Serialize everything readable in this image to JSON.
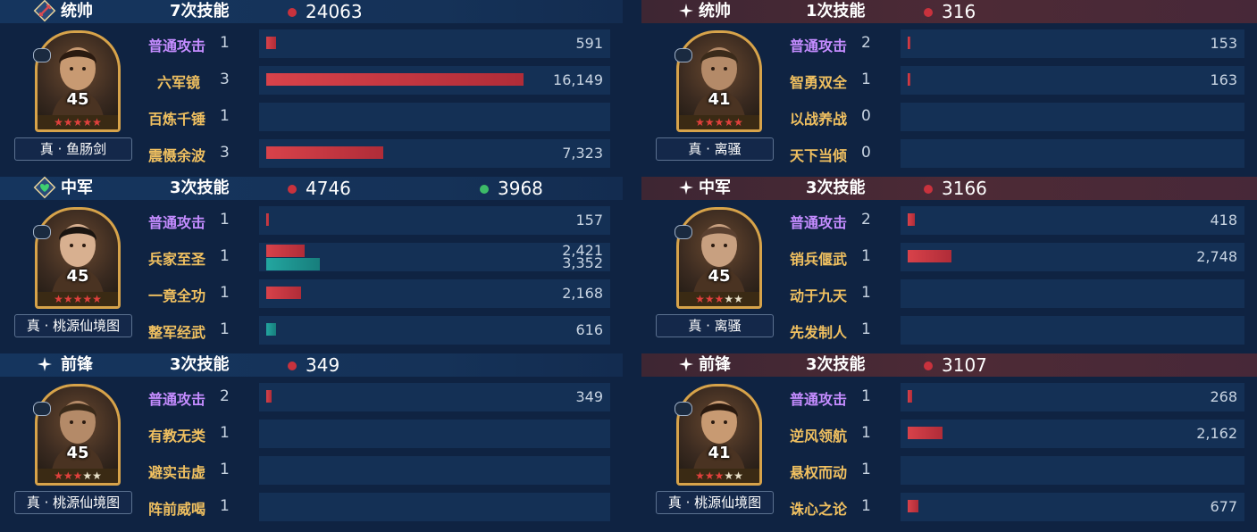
{
  "left": {
    "sections": [
      {
        "role": "统帅",
        "role_icon": "sword-badge-icon",
        "skill_count": "7次技能",
        "damage": "24063",
        "heal": null,
        "level": "45",
        "stars_red": 5,
        "gear": "真 · 鱼肠剑",
        "skills": [
          {
            "name": "普通攻击",
            "level": "1",
            "type": "normal",
            "damage": 591,
            "damage_label": "591",
            "heal": null
          },
          {
            "name": "六军镜",
            "level": "3",
            "type": "skill",
            "damage": 16149,
            "damage_label": "16,149",
            "heal": null
          },
          {
            "name": "百炼千锤",
            "level": "1",
            "type": "skill",
            "damage": null,
            "damage_label": "",
            "heal": null
          },
          {
            "name": "震慑余波",
            "level": "3",
            "type": "skill",
            "damage": 7323,
            "damage_label": "7,323",
            "heal": null
          }
        ]
      },
      {
        "role": "中军",
        "role_icon": "heart-badge-icon",
        "skill_count": "3次技能",
        "damage": "4746",
        "heal": "3968",
        "level": "45",
        "stars_red": 5,
        "gear": "真 · 桃源仙境图",
        "skills": [
          {
            "name": "普通攻击",
            "level": "1",
            "type": "normal",
            "damage": 157,
            "damage_label": "157",
            "heal": null
          },
          {
            "name": "兵家至圣",
            "level": "1",
            "type": "skill",
            "damage": 2421,
            "damage_label": "2,421",
            "heal": 3352,
            "heal_label": "3,352"
          },
          {
            "name": "一竟全功",
            "level": "1",
            "type": "skill",
            "damage": 2168,
            "damage_label": "2,168",
            "heal": null
          },
          {
            "name": "整军经武",
            "level": "1",
            "type": "skill",
            "damage": null,
            "damage_label": "",
            "heal": 616,
            "heal_label": "616"
          }
        ]
      },
      {
        "role": "前锋",
        "role_icon": "sparkle-icon",
        "skill_count": "3次技能",
        "damage": "349",
        "heal": null,
        "level": "45",
        "stars_red": 3,
        "gear": "真 · 桃源仙境图",
        "skills": [
          {
            "name": "普通攻击",
            "level": "2",
            "type": "normal",
            "damage": 349,
            "damage_label": "349",
            "heal": null
          },
          {
            "name": "有教无类",
            "level": "1",
            "type": "skill",
            "damage": null,
            "damage_label": "",
            "heal": null
          },
          {
            "name": "避实击虚",
            "level": "1",
            "type": "skill",
            "damage": null,
            "damage_label": "",
            "heal": null
          },
          {
            "name": "阵前威喝",
            "level": "1",
            "type": "skill",
            "damage": null,
            "damage_label": "",
            "heal": null
          }
        ]
      }
    ],
    "max_value": 16149
  },
  "right": {
    "sections": [
      {
        "role": "统帅",
        "role_icon": "sparkle-icon",
        "skill_count": "1次技能",
        "damage": "316",
        "heal": null,
        "level": "41",
        "stars_red": 5,
        "gear": "真 · 离骚",
        "skills": [
          {
            "name": "普通攻击",
            "level": "2",
            "type": "normal",
            "damage": 153,
            "damage_label": "153",
            "heal": null
          },
          {
            "name": "智勇双全",
            "level": "1",
            "type": "skill",
            "damage": 163,
            "damage_label": "163",
            "heal": null
          },
          {
            "name": "以战养战",
            "level": "0",
            "type": "skill",
            "damage": null,
            "damage_label": "",
            "heal": null
          },
          {
            "name": "天下当倾",
            "level": "0",
            "type": "skill",
            "damage": null,
            "damage_label": "",
            "heal": null
          }
        ]
      },
      {
        "role": "中军",
        "role_icon": "sparkle-icon",
        "skill_count": "3次技能",
        "damage": "3166",
        "heal": null,
        "level": "45",
        "stars_red": 3,
        "gear": "真 · 离骚",
        "skills": [
          {
            "name": "普通攻击",
            "level": "2",
            "type": "normal",
            "damage": 418,
            "damage_label": "418",
            "heal": null
          },
          {
            "name": "销兵偃武",
            "level": "1",
            "type": "skill",
            "damage": 2748,
            "damage_label": "2,748",
            "heal": null
          },
          {
            "name": "动于九天",
            "level": "1",
            "type": "skill",
            "damage": null,
            "damage_label": "",
            "heal": null
          },
          {
            "name": "先发制人",
            "level": "1",
            "type": "skill",
            "damage": null,
            "damage_label": "",
            "heal": null
          }
        ]
      },
      {
        "role": "前锋",
        "role_icon": "sparkle-icon",
        "skill_count": "3次技能",
        "damage": "3107",
        "heal": null,
        "level": "41",
        "stars_red": 3,
        "gear": "真 · 桃源仙境图",
        "skills": [
          {
            "name": "普通攻击",
            "level": "1",
            "type": "normal",
            "damage": 268,
            "damage_label": "268",
            "heal": null
          },
          {
            "name": "逆风领航",
            "level": "1",
            "type": "skill",
            "damage": 2162,
            "damage_label": "2,162",
            "heal": null
          },
          {
            "name": "悬权而动",
            "level": "1",
            "type": "skill",
            "damage": null,
            "damage_label": "",
            "heal": null
          },
          {
            "name": "诛心之论",
            "level": "1",
            "type": "skill",
            "damage": 677,
            "damage_label": "677",
            "heal": null
          }
        ]
      }
    ],
    "max_value": 16149
  },
  "colors": {
    "damage_bar": "#c8323d",
    "heal_bar": "#1f9a96",
    "normal_attack_text": "#c48cff",
    "skill_text": "#f0c060",
    "frame_gold": "#d7a34a"
  }
}
